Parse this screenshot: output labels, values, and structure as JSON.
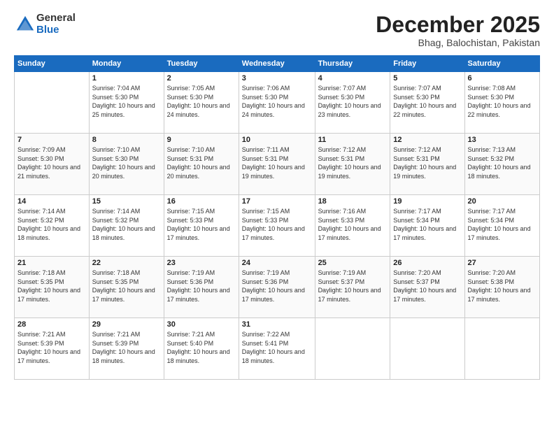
{
  "logo": {
    "general": "General",
    "blue": "Blue"
  },
  "title": "December 2025",
  "location": "Bhag, Balochistan, Pakistan",
  "days_header": [
    "Sunday",
    "Monday",
    "Tuesday",
    "Wednesday",
    "Thursday",
    "Friday",
    "Saturday"
  ],
  "weeks": [
    [
      {
        "day": "",
        "sunrise": "",
        "sunset": "",
        "daylight": ""
      },
      {
        "day": "1",
        "sunrise": "Sunrise: 7:04 AM",
        "sunset": "Sunset: 5:30 PM",
        "daylight": "Daylight: 10 hours and 25 minutes."
      },
      {
        "day": "2",
        "sunrise": "Sunrise: 7:05 AM",
        "sunset": "Sunset: 5:30 PM",
        "daylight": "Daylight: 10 hours and 24 minutes."
      },
      {
        "day": "3",
        "sunrise": "Sunrise: 7:06 AM",
        "sunset": "Sunset: 5:30 PM",
        "daylight": "Daylight: 10 hours and 24 minutes."
      },
      {
        "day": "4",
        "sunrise": "Sunrise: 7:07 AM",
        "sunset": "Sunset: 5:30 PM",
        "daylight": "Daylight: 10 hours and 23 minutes."
      },
      {
        "day": "5",
        "sunrise": "Sunrise: 7:07 AM",
        "sunset": "Sunset: 5:30 PM",
        "daylight": "Daylight: 10 hours and 22 minutes."
      },
      {
        "day": "6",
        "sunrise": "Sunrise: 7:08 AM",
        "sunset": "Sunset: 5:30 PM",
        "daylight": "Daylight: 10 hours and 22 minutes."
      }
    ],
    [
      {
        "day": "7",
        "sunrise": "Sunrise: 7:09 AM",
        "sunset": "Sunset: 5:30 PM",
        "daylight": "Daylight: 10 hours and 21 minutes."
      },
      {
        "day": "8",
        "sunrise": "Sunrise: 7:10 AM",
        "sunset": "Sunset: 5:30 PM",
        "daylight": "Daylight: 10 hours and 20 minutes."
      },
      {
        "day": "9",
        "sunrise": "Sunrise: 7:10 AM",
        "sunset": "Sunset: 5:31 PM",
        "daylight": "Daylight: 10 hours and 20 minutes."
      },
      {
        "day": "10",
        "sunrise": "Sunrise: 7:11 AM",
        "sunset": "Sunset: 5:31 PM",
        "daylight": "Daylight: 10 hours and 19 minutes."
      },
      {
        "day": "11",
        "sunrise": "Sunrise: 7:12 AM",
        "sunset": "Sunset: 5:31 PM",
        "daylight": "Daylight: 10 hours and 19 minutes."
      },
      {
        "day": "12",
        "sunrise": "Sunrise: 7:12 AM",
        "sunset": "Sunset: 5:31 PM",
        "daylight": "Daylight: 10 hours and 19 minutes."
      },
      {
        "day": "13",
        "sunrise": "Sunrise: 7:13 AM",
        "sunset": "Sunset: 5:32 PM",
        "daylight": "Daylight: 10 hours and 18 minutes."
      }
    ],
    [
      {
        "day": "14",
        "sunrise": "Sunrise: 7:14 AM",
        "sunset": "Sunset: 5:32 PM",
        "daylight": "Daylight: 10 hours and 18 minutes."
      },
      {
        "day": "15",
        "sunrise": "Sunrise: 7:14 AM",
        "sunset": "Sunset: 5:32 PM",
        "daylight": "Daylight: 10 hours and 18 minutes."
      },
      {
        "day": "16",
        "sunrise": "Sunrise: 7:15 AM",
        "sunset": "Sunset: 5:33 PM",
        "daylight": "Daylight: 10 hours and 17 minutes."
      },
      {
        "day": "17",
        "sunrise": "Sunrise: 7:15 AM",
        "sunset": "Sunset: 5:33 PM",
        "daylight": "Daylight: 10 hours and 17 minutes."
      },
      {
        "day": "18",
        "sunrise": "Sunrise: 7:16 AM",
        "sunset": "Sunset: 5:33 PM",
        "daylight": "Daylight: 10 hours and 17 minutes."
      },
      {
        "day": "19",
        "sunrise": "Sunrise: 7:17 AM",
        "sunset": "Sunset: 5:34 PM",
        "daylight": "Daylight: 10 hours and 17 minutes."
      },
      {
        "day": "20",
        "sunrise": "Sunrise: 7:17 AM",
        "sunset": "Sunset: 5:34 PM",
        "daylight": "Daylight: 10 hours and 17 minutes."
      }
    ],
    [
      {
        "day": "21",
        "sunrise": "Sunrise: 7:18 AM",
        "sunset": "Sunset: 5:35 PM",
        "daylight": "Daylight: 10 hours and 17 minutes."
      },
      {
        "day": "22",
        "sunrise": "Sunrise: 7:18 AM",
        "sunset": "Sunset: 5:35 PM",
        "daylight": "Daylight: 10 hours and 17 minutes."
      },
      {
        "day": "23",
        "sunrise": "Sunrise: 7:19 AM",
        "sunset": "Sunset: 5:36 PM",
        "daylight": "Daylight: 10 hours and 17 minutes."
      },
      {
        "day": "24",
        "sunrise": "Sunrise: 7:19 AM",
        "sunset": "Sunset: 5:36 PM",
        "daylight": "Daylight: 10 hours and 17 minutes."
      },
      {
        "day": "25",
        "sunrise": "Sunrise: 7:19 AM",
        "sunset": "Sunset: 5:37 PM",
        "daylight": "Daylight: 10 hours and 17 minutes."
      },
      {
        "day": "26",
        "sunrise": "Sunrise: 7:20 AM",
        "sunset": "Sunset: 5:37 PM",
        "daylight": "Daylight: 10 hours and 17 minutes."
      },
      {
        "day": "27",
        "sunrise": "Sunrise: 7:20 AM",
        "sunset": "Sunset: 5:38 PM",
        "daylight": "Daylight: 10 hours and 17 minutes."
      }
    ],
    [
      {
        "day": "28",
        "sunrise": "Sunrise: 7:21 AM",
        "sunset": "Sunset: 5:39 PM",
        "daylight": "Daylight: 10 hours and 17 minutes."
      },
      {
        "day": "29",
        "sunrise": "Sunrise: 7:21 AM",
        "sunset": "Sunset: 5:39 PM",
        "daylight": "Daylight: 10 hours and 18 minutes."
      },
      {
        "day": "30",
        "sunrise": "Sunrise: 7:21 AM",
        "sunset": "Sunset: 5:40 PM",
        "daylight": "Daylight: 10 hours and 18 minutes."
      },
      {
        "day": "31",
        "sunrise": "Sunrise: 7:22 AM",
        "sunset": "Sunset: 5:41 PM",
        "daylight": "Daylight: 10 hours and 18 minutes."
      },
      {
        "day": "",
        "sunrise": "",
        "sunset": "",
        "daylight": ""
      },
      {
        "day": "",
        "sunrise": "",
        "sunset": "",
        "daylight": ""
      },
      {
        "day": "",
        "sunrise": "",
        "sunset": "",
        "daylight": ""
      }
    ]
  ]
}
